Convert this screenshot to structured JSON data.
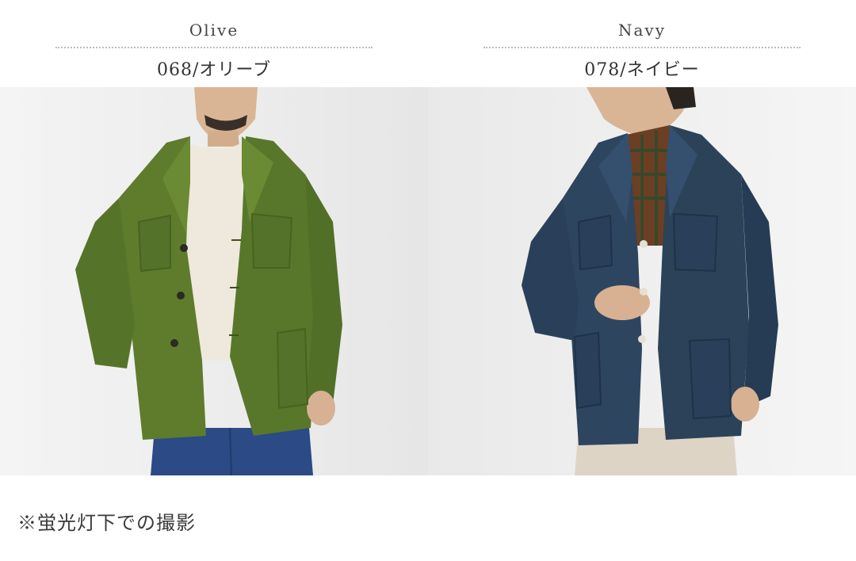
{
  "variants": [
    {
      "name_en": "Olive",
      "code": "068/オリーブ"
    },
    {
      "name_en": "Navy",
      "code": "078/ネイビー"
    }
  ],
  "note": "※蛍光灯下での撮影",
  "colors": {
    "olive_jacket": "#5c7a2a",
    "navy_jacket": "#2e4560",
    "background": "#f1f1f1",
    "divider": "#bdbdbd"
  }
}
